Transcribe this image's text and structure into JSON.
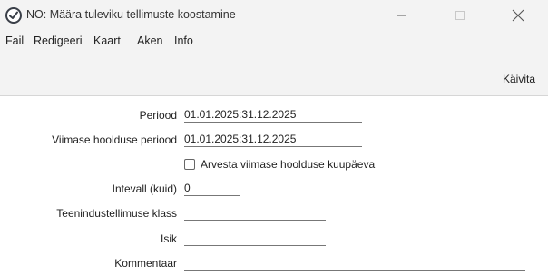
{
  "window": {
    "title": "NO: Määra tuleviku tellimuste koostamine",
    "icon": "app-logo-icon",
    "controls": [
      "minimize-icon",
      "maximize-icon",
      "close-icon"
    ]
  },
  "menu": {
    "items": [
      "Fail",
      "Redigeeri",
      "Kaart",
      "Aken",
      "Info"
    ]
  },
  "toolbar": {
    "run_label": "Käivita"
  },
  "form": {
    "period_label": "Periood",
    "period_value": "01.01.2025:31.12.2025",
    "last_maint_period_label": "Viimase hoolduse periood",
    "last_maint_period_value": "01.01.2025:31.12.2025",
    "consider_last_date_label": "Arvesta viimase hoolduse kuupäeva",
    "consider_last_date_checked": false,
    "interval_label": "Intevall (kuid)",
    "interval_value": "0",
    "service_order_class_label": "Teenindustellimuse klass",
    "service_order_class_value": "",
    "person_label": "Isik",
    "person_value": "",
    "comment_label": "Kommentaar",
    "comment_value": ""
  }
}
